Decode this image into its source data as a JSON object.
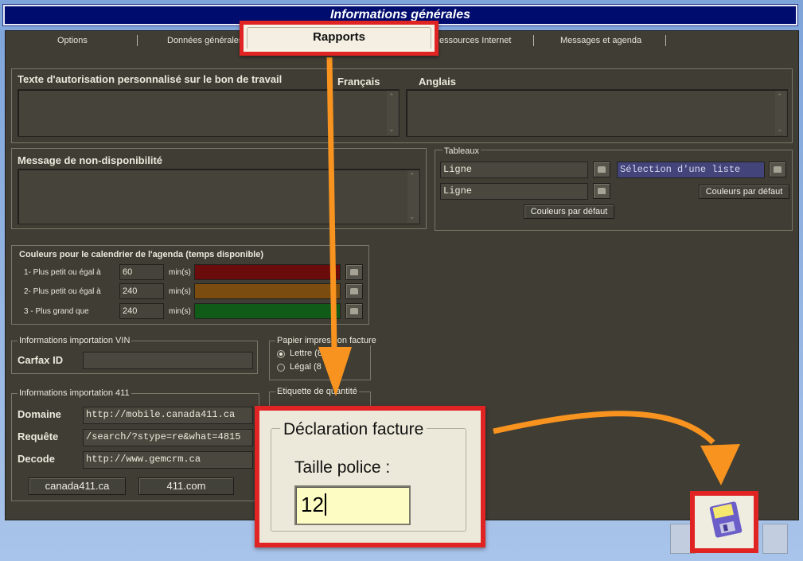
{
  "window": {
    "title": "Informations générales"
  },
  "tabs": [
    {
      "label": "Options"
    },
    {
      "label": "Données générales"
    },
    {
      "label": "Rapports",
      "active": true
    },
    {
      "label": "essources Internet"
    },
    {
      "label": "Messages et agenda"
    }
  ],
  "authorization": {
    "title": "Texte d'autorisation personnalisé sur le bon de travail",
    "francais_label": "Français",
    "anglais_label": "Anglais"
  },
  "unavailability": {
    "title": "Message de non-disponibilité"
  },
  "tableaux": {
    "title": "Tableaux",
    "field1": "Ligne",
    "field2": "Ligne",
    "selection": "Sélection d'une liste",
    "btn_default_right": "Couleurs par défaut",
    "btn_default_center": "Couleurs par défaut"
  },
  "agenda_colors": {
    "title": "Couleurs pour le calendrier de l'agenda (temps disponible)",
    "rows": [
      {
        "label": "1- Plus petit ou égal à",
        "value": "60",
        "unit": "min(s)",
        "color": "#6b0c0c"
      },
      {
        "label": "2- Plus petit ou égal à",
        "value": "240",
        "unit": "min(s)",
        "color": "#7a4c10"
      },
      {
        "label": "3 - Plus grand que",
        "value": "240",
        "unit": "min(s)",
        "color": "#0f5b17"
      }
    ]
  },
  "vin": {
    "title": "Informations importation VIN",
    "carfax_label": "Carfax ID"
  },
  "paper": {
    "title": "Papier impression facture",
    "opt1": "Lettre (8.5x11",
    "opt2": "Légal (8"
  },
  "quantity": {
    "title": "Etiquette de quantité"
  },
  "import411": {
    "title": "Informations importation 411",
    "domaine_label": "Domaine",
    "domaine_value": "http://mobile.canada411.ca",
    "requete_label": "Requête",
    "requete_value": "/search/?stype=re&what=4815",
    "decode_label": "Decode",
    "decode_value": "http://www.gemcrm.ca",
    "btn_canada": "canada411.ca",
    "btn_411": "411.com"
  },
  "declaration": {
    "title": "Déclaration facture",
    "font_label": "Taille police :",
    "font_value": "12"
  },
  "colors": {
    "highlight": "#e02424",
    "arrow": "#f7931e"
  },
  "icons": [
    "floppy-save-icon",
    "exit-icon",
    "delete-icon"
  ]
}
